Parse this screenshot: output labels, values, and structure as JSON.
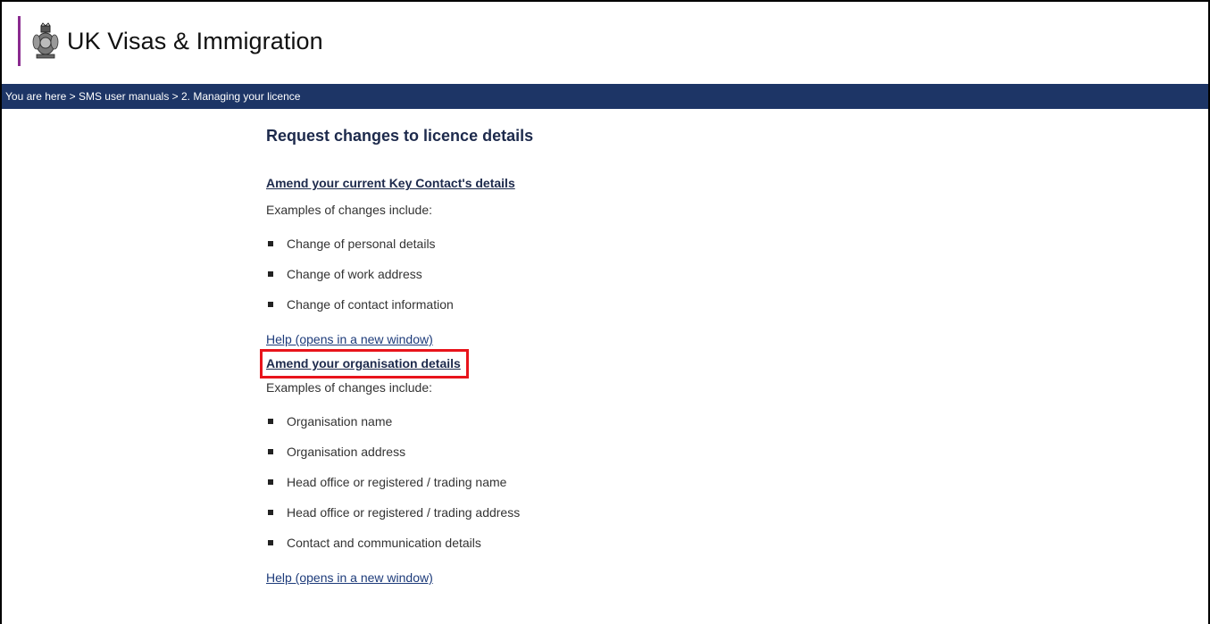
{
  "header": {
    "brand_name": "UK Visas & Immigration",
    "brand_bar_color": "#8a2a8f",
    "crest_icon": "royal-crest-icon"
  },
  "breadcrumb": {
    "text": "You are here > SMS user manuals > 2. Managing your licence",
    "background_color": "#1d3566"
  },
  "main": {
    "title": "Request changes to licence details",
    "sections": [
      {
        "link_label": "Amend your current Key Contact's details",
        "examples_label": "Examples of changes include:",
        "items": [
          "Change of personal details",
          "Change of work address",
          "Change of contact information"
        ],
        "help_label": "Help (opens in a new window)"
      },
      {
        "link_label": "Amend your organisation details",
        "examples_label": "Examples of changes include:",
        "items": [
          "Organisation name",
          "Organisation address",
          "Head office or registered / trading name",
          "Head office or registered / trading address",
          "Contact and communication details"
        ],
        "help_label": "Help (opens in a new window)"
      }
    ],
    "highlight_color": "#e8141b"
  }
}
